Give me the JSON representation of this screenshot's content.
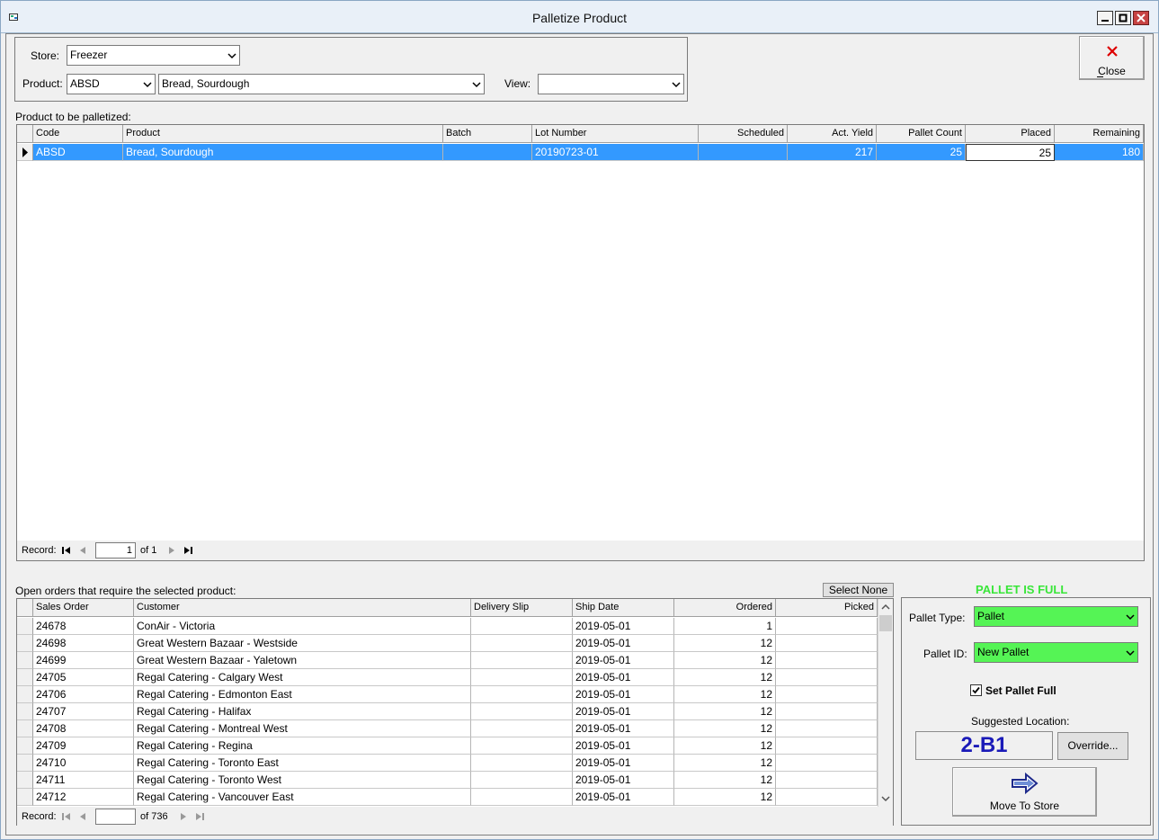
{
  "window": {
    "title": "Palletize Product",
    "accent": "#3399ff",
    "green": "#55f455"
  },
  "filters": {
    "store_label": "Store:",
    "store_value": "Freezer",
    "product_label": "Product:",
    "product_code": "ABSD",
    "product_name": "Bread, Sourdough",
    "view_label": "View:",
    "view_value": ""
  },
  "close_button": {
    "label": "Close",
    "icon": "close-x-icon"
  },
  "product_grid": {
    "caption": "Product to be palletized:",
    "columns": [
      "Code",
      "Product",
      "Batch",
      "Lot Number",
      "Scheduled",
      "Act. Yield",
      "Pallet Count",
      "Placed",
      "Remaining"
    ],
    "rows": [
      {
        "code": "ABSD",
        "product": "Bread, Sourdough",
        "batch": "",
        "lot": "20190723-01",
        "scheduled": "",
        "yield": "217",
        "pallet_count": "25",
        "placed": "25",
        "remaining": "180"
      }
    ],
    "nav": {
      "label": "Record:",
      "current": "1",
      "of_text": "of 1"
    }
  },
  "orders_grid": {
    "caption": "Open orders that require the selected product:",
    "select_none": "Select None",
    "columns": [
      "Sales Order",
      "Customer",
      "Delivery Slip",
      "Ship Date",
      "Ordered",
      "Picked"
    ],
    "rows": [
      {
        "so": "24678",
        "customer": "ConAir - Victoria",
        "slip": "",
        "date": "2019-05-01",
        "ordered": "1",
        "picked": ""
      },
      {
        "so": "24698",
        "customer": "Great Western Bazaar - Westside",
        "slip": "",
        "date": "2019-05-01",
        "ordered": "12",
        "picked": ""
      },
      {
        "so": "24699",
        "customer": "Great Western Bazaar - Yaletown",
        "slip": "",
        "date": "2019-05-01",
        "ordered": "12",
        "picked": ""
      },
      {
        "so": "24705",
        "customer": "Regal Catering - Calgary West",
        "slip": "",
        "date": "2019-05-01",
        "ordered": "12",
        "picked": ""
      },
      {
        "so": "24706",
        "customer": "Regal Catering - Edmonton East",
        "slip": "",
        "date": "2019-05-01",
        "ordered": "12",
        "picked": ""
      },
      {
        "so": "24707",
        "customer": "Regal Catering - Halifax",
        "slip": "",
        "date": "2019-05-01",
        "ordered": "12",
        "picked": ""
      },
      {
        "so": "24708",
        "customer": "Regal Catering - Montreal West",
        "slip": "",
        "date": "2019-05-01",
        "ordered": "12",
        "picked": ""
      },
      {
        "so": "24709",
        "customer": "Regal Catering - Regina",
        "slip": "",
        "date": "2019-05-01",
        "ordered": "12",
        "picked": ""
      },
      {
        "so": "24710",
        "customer": "Regal Catering - Toronto East",
        "slip": "",
        "date": "2019-05-01",
        "ordered": "12",
        "picked": ""
      },
      {
        "so": "24711",
        "customer": "Regal Catering - Toronto West",
        "slip": "",
        "date": "2019-05-01",
        "ordered": "12",
        "picked": ""
      },
      {
        "so": "24712",
        "customer": "Regal Catering - Vancouver East",
        "slip": "",
        "date": "2019-05-01",
        "ordered": "12",
        "picked": ""
      }
    ],
    "nav": {
      "label": "Record:",
      "current": "",
      "of_text": "of 736"
    }
  },
  "pallet": {
    "status": "PALLET IS FULL",
    "type_label": "Pallet Type:",
    "type_value": "Pallet",
    "id_label": "Pallet ID:",
    "id_value": "New Pallet",
    "set_full_label": "Set Pallet Full",
    "set_full_checked": true,
    "suggested_label": "Suggested Location:",
    "suggested_value": "2-B1",
    "override_label": "Override...",
    "move_label": "Move To Store"
  }
}
